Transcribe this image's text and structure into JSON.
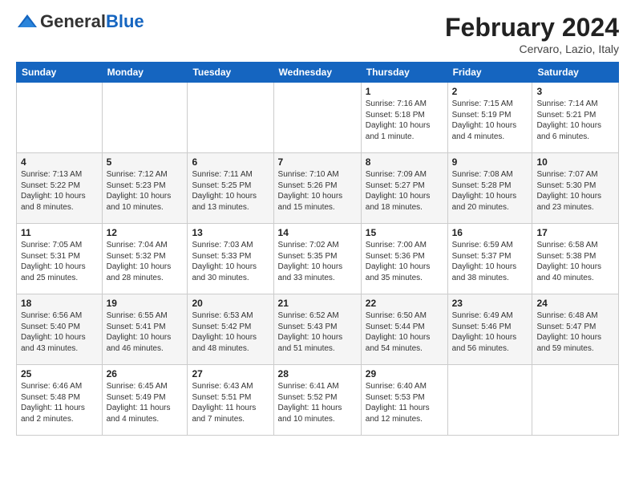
{
  "header": {
    "logo_general": "General",
    "logo_blue": "Blue",
    "main_title": "February 2024",
    "subtitle": "Cervaro, Lazio, Italy"
  },
  "days_of_week": [
    "Sunday",
    "Monday",
    "Tuesday",
    "Wednesday",
    "Thursday",
    "Friday",
    "Saturday"
  ],
  "weeks": [
    [
      {
        "num": "",
        "info": ""
      },
      {
        "num": "",
        "info": ""
      },
      {
        "num": "",
        "info": ""
      },
      {
        "num": "",
        "info": ""
      },
      {
        "num": "1",
        "info": "Sunrise: 7:16 AM\nSunset: 5:18 PM\nDaylight: 10 hours and 1 minute."
      },
      {
        "num": "2",
        "info": "Sunrise: 7:15 AM\nSunset: 5:19 PM\nDaylight: 10 hours and 4 minutes."
      },
      {
        "num": "3",
        "info": "Sunrise: 7:14 AM\nSunset: 5:21 PM\nDaylight: 10 hours and 6 minutes."
      }
    ],
    [
      {
        "num": "4",
        "info": "Sunrise: 7:13 AM\nSunset: 5:22 PM\nDaylight: 10 hours and 8 minutes."
      },
      {
        "num": "5",
        "info": "Sunrise: 7:12 AM\nSunset: 5:23 PM\nDaylight: 10 hours and 10 minutes."
      },
      {
        "num": "6",
        "info": "Sunrise: 7:11 AM\nSunset: 5:25 PM\nDaylight: 10 hours and 13 minutes."
      },
      {
        "num": "7",
        "info": "Sunrise: 7:10 AM\nSunset: 5:26 PM\nDaylight: 10 hours and 15 minutes."
      },
      {
        "num": "8",
        "info": "Sunrise: 7:09 AM\nSunset: 5:27 PM\nDaylight: 10 hours and 18 minutes."
      },
      {
        "num": "9",
        "info": "Sunrise: 7:08 AM\nSunset: 5:28 PM\nDaylight: 10 hours and 20 minutes."
      },
      {
        "num": "10",
        "info": "Sunrise: 7:07 AM\nSunset: 5:30 PM\nDaylight: 10 hours and 23 minutes."
      }
    ],
    [
      {
        "num": "11",
        "info": "Sunrise: 7:05 AM\nSunset: 5:31 PM\nDaylight: 10 hours and 25 minutes."
      },
      {
        "num": "12",
        "info": "Sunrise: 7:04 AM\nSunset: 5:32 PM\nDaylight: 10 hours and 28 minutes."
      },
      {
        "num": "13",
        "info": "Sunrise: 7:03 AM\nSunset: 5:33 PM\nDaylight: 10 hours and 30 minutes."
      },
      {
        "num": "14",
        "info": "Sunrise: 7:02 AM\nSunset: 5:35 PM\nDaylight: 10 hours and 33 minutes."
      },
      {
        "num": "15",
        "info": "Sunrise: 7:00 AM\nSunset: 5:36 PM\nDaylight: 10 hours and 35 minutes."
      },
      {
        "num": "16",
        "info": "Sunrise: 6:59 AM\nSunset: 5:37 PM\nDaylight: 10 hours and 38 minutes."
      },
      {
        "num": "17",
        "info": "Sunrise: 6:58 AM\nSunset: 5:38 PM\nDaylight: 10 hours and 40 minutes."
      }
    ],
    [
      {
        "num": "18",
        "info": "Sunrise: 6:56 AM\nSunset: 5:40 PM\nDaylight: 10 hours and 43 minutes."
      },
      {
        "num": "19",
        "info": "Sunrise: 6:55 AM\nSunset: 5:41 PM\nDaylight: 10 hours and 46 minutes."
      },
      {
        "num": "20",
        "info": "Sunrise: 6:53 AM\nSunset: 5:42 PM\nDaylight: 10 hours and 48 minutes."
      },
      {
        "num": "21",
        "info": "Sunrise: 6:52 AM\nSunset: 5:43 PM\nDaylight: 10 hours and 51 minutes."
      },
      {
        "num": "22",
        "info": "Sunrise: 6:50 AM\nSunset: 5:44 PM\nDaylight: 10 hours and 54 minutes."
      },
      {
        "num": "23",
        "info": "Sunrise: 6:49 AM\nSunset: 5:46 PM\nDaylight: 10 hours and 56 minutes."
      },
      {
        "num": "24",
        "info": "Sunrise: 6:48 AM\nSunset: 5:47 PM\nDaylight: 10 hours and 59 minutes."
      }
    ],
    [
      {
        "num": "25",
        "info": "Sunrise: 6:46 AM\nSunset: 5:48 PM\nDaylight: 11 hours and 2 minutes."
      },
      {
        "num": "26",
        "info": "Sunrise: 6:45 AM\nSunset: 5:49 PM\nDaylight: 11 hours and 4 minutes."
      },
      {
        "num": "27",
        "info": "Sunrise: 6:43 AM\nSunset: 5:51 PM\nDaylight: 11 hours and 7 minutes."
      },
      {
        "num": "28",
        "info": "Sunrise: 6:41 AM\nSunset: 5:52 PM\nDaylight: 11 hours and 10 minutes."
      },
      {
        "num": "29",
        "info": "Sunrise: 6:40 AM\nSunset: 5:53 PM\nDaylight: 11 hours and 12 minutes."
      },
      {
        "num": "",
        "info": ""
      },
      {
        "num": "",
        "info": ""
      }
    ]
  ]
}
